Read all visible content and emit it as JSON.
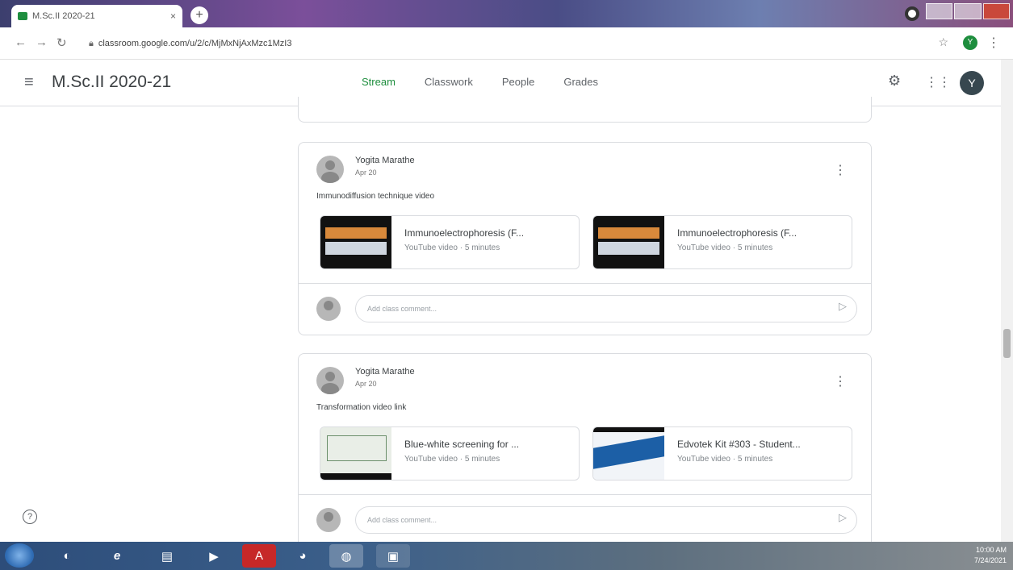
{
  "browser": {
    "tab_title": "M.Sc.II 2020-21",
    "tab_close": "×",
    "new_tab": "+",
    "url": "classroom.google.com/u/2/c/MjMxNjAxMzc1MzI3",
    "ext_letter": "Y"
  },
  "header": {
    "class_name": "M.Sc.II 2020-21",
    "tabs": [
      "Stream",
      "Classwork",
      "People",
      "Grades"
    ],
    "active_tab": "Stream",
    "avatar_letter": "Y"
  },
  "posts": [
    {
      "author": "Yogita Marathe",
      "date": "Apr 20",
      "text": "Immunodiffusion technique video",
      "attachments": [
        {
          "title": "Immunoelectrophoresis (F...",
          "subtitle": "YouTube video · 5 minutes"
        },
        {
          "title": "Immunoelectrophoresis (F...",
          "subtitle": "YouTube video · 5 minutes"
        }
      ],
      "comment_placeholder": "Add class comment..."
    },
    {
      "author": "Yogita Marathe",
      "date": "Apr 20",
      "text": "Transformation video link",
      "attachments": [
        {
          "title": "Blue-white screening for ...",
          "subtitle": "YouTube video · 5 minutes"
        },
        {
          "title": "Edvotek Kit #303 - Student...",
          "subtitle": "YouTube video · 5 minutes"
        }
      ],
      "comment_placeholder": "Add class comment..."
    }
  ],
  "help": "?",
  "taskbar": {
    "time": "10:00 AM",
    "date": "7/24/2021"
  },
  "colors": {
    "accent": "#1e8e3e",
    "border": "#dadce0"
  }
}
